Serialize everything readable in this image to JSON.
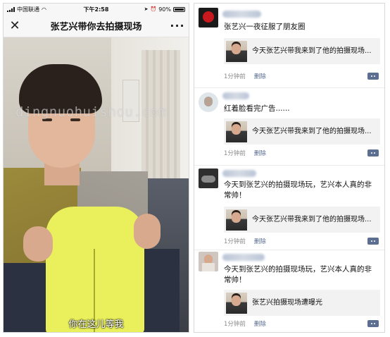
{
  "status_bar": {
    "carrier": "中国联通",
    "time": "下午2:58",
    "battery": "90%"
  },
  "nav": {
    "title": "张艺兴带你去拍摄现场",
    "close_glyph": "✕",
    "more_glyph": "···"
  },
  "video": {
    "subtitle": "你在这儿等我"
  },
  "watermark": "dingnuohuishou.com",
  "posts": [
    {
      "text": "张艺兴一夜征服了朋友圈",
      "card_title": "今天张艺兴带我来到了他的拍摄现场...",
      "time": "1分钟前",
      "delete": "删除"
    },
    {
      "text": "红着脸看完广告......",
      "card_title": "今天张艺兴带我来到了他的拍摄现场...",
      "time": "1分钟前",
      "delete": "删除"
    },
    {
      "text": "今天到张艺兴的拍摄现场玩，艺兴本人真的非常帅！",
      "card_title": "今天张艺兴带我来到了他的拍摄现场...",
      "time": "1分钟前",
      "delete": "删除"
    },
    {
      "text": "今天到张艺兴的拍摄现场玩，艺兴本人真的非常帅！",
      "card_title": "张艺兴拍摄现场遭曝光",
      "time": "1分钟前",
      "delete": "删除"
    }
  ],
  "colors": {
    "link_blue": "#56698e",
    "card_bg": "#f2f2f2",
    "hoodie": "#e9f05c"
  }
}
